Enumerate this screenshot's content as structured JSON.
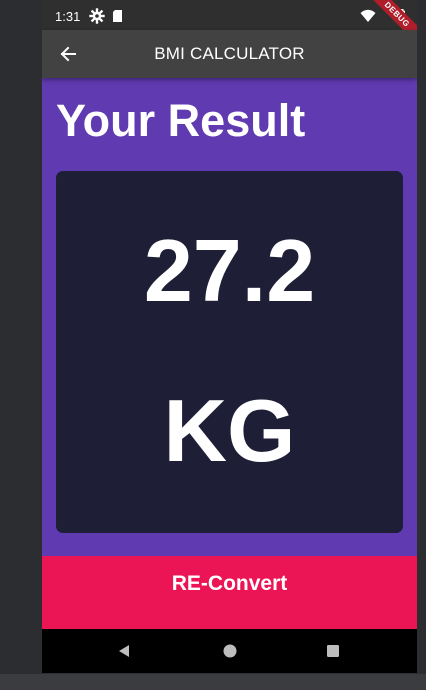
{
  "status_bar": {
    "time": "1:31",
    "left_icons": [
      "gear-icon",
      "sd-card-icon"
    ],
    "right_icons": [
      "wifi-icon",
      "battery-icon"
    ],
    "debug_banner": "DEBUG"
  },
  "app_bar": {
    "title": "BMI CALCULATOR",
    "back_icon": "arrow-back-icon"
  },
  "result": {
    "heading": "Your Result",
    "value": "27.2",
    "unit": "KG"
  },
  "actions": {
    "reconvert_label": "RE-Convert"
  },
  "nav_bar": {
    "icons": [
      "nav-back-icon",
      "nav-home-icon",
      "nav-recents-icon"
    ]
  },
  "colors": {
    "app_bar": "#424242",
    "background": "#5f3ab0",
    "card": "#1e1f36",
    "accent": "#eb1555",
    "text": "#ffffff"
  }
}
